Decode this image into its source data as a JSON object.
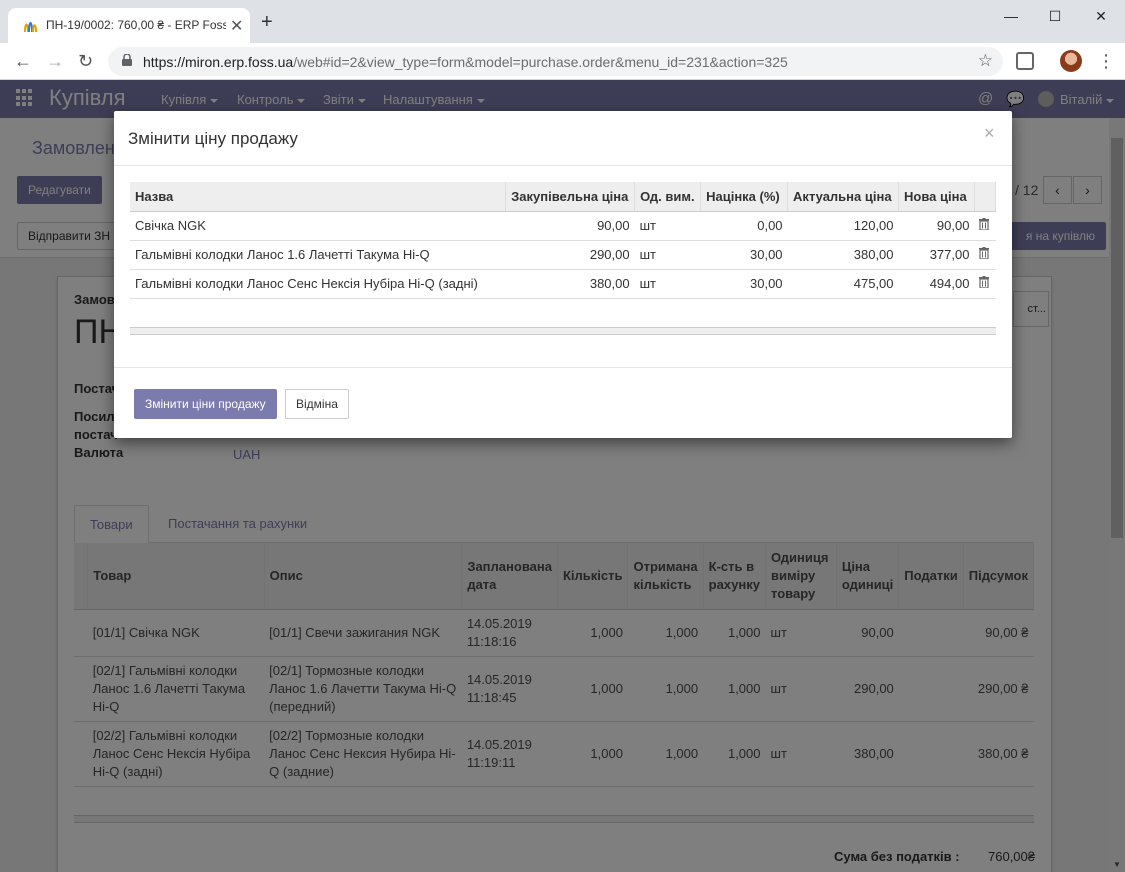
{
  "browser": {
    "tab_title": "ПН-19/0002: 760,00 ₴ - ERP Foss",
    "url_host": "https://miron.erp.foss.ua",
    "url_path": "/web#id=2&view_type=form&model=purchase.order&menu_id=231&action=325"
  },
  "app": {
    "brand": "Купівля",
    "menu": [
      "Купівля",
      "Контроль",
      "Звіти",
      "Налаштування"
    ],
    "user": "Віталій"
  },
  "control_panel": {
    "breadcrumb": "Замовлен",
    "edit_label": "Редагувати",
    "send_label": "Відправити ЗН",
    "confirm_label": "я на купівлю",
    "pager": "/ 12"
  },
  "form": {
    "order_label": "Замов",
    "title": "ПН",
    "supplier_label": "Постач",
    "ref_label_1": "Посила",
    "ref_label_2": "постач",
    "currency_label": "Валюта",
    "currency_value": "UAH",
    "status_btn": "ст...",
    "tabs": [
      "Товари",
      "Постачання та рахунки"
    ],
    "line_headers": [
      "Товар",
      "Опис",
      "Запланована дата",
      "Кількість",
      "Отримана кількість",
      "К-сть в рахунку",
      "Одиниця виміру товару",
      "Ціна одиниці",
      "Податки",
      "Підсумок"
    ],
    "lines": [
      {
        "product": "[01/1] Свічка NGK",
        "desc": "[01/1] Свечи зажигания NGK",
        "date": "14.05.2019 11:18:16",
        "qty": "1,000",
        "received": "1,000",
        "invoiced": "1,000",
        "uom": "шт",
        "price": "90,00",
        "taxes": "",
        "subtotal": "90,00 ₴"
      },
      {
        "product": "[02/1] Гальмівні колодки Ланос 1.6 Лачетті Такума Hi-Q",
        "desc": "[02/1] Тормозные колодки Ланос 1.6 Лачетти Такума Hi-Q (передний)",
        "date": "14.05.2019 11:18:45",
        "qty": "1,000",
        "received": "1,000",
        "invoiced": "1,000",
        "uom": "шт",
        "price": "290,00",
        "taxes": "",
        "subtotal": "290,00 ₴"
      },
      {
        "product": "[02/2] Гальмівні колодки Ланос Сенс Нексія Нубіра Hi-Q (задні)",
        "desc": "[02/2] Тормозные колодки Ланос Сенс Нексия Нубира Hi-Q (задние)",
        "date": "14.05.2019 11:19:11",
        "qty": "1,000",
        "received": "1,000",
        "invoiced": "1,000",
        "uom": "шт",
        "price": "380,00",
        "taxes": "",
        "subtotal": "380,00 ₴"
      }
    ],
    "total_label": "Сума без податків :",
    "total_value": "760,00₴"
  },
  "modal": {
    "title": "Змінити ціну продажу",
    "close": "×",
    "headers": [
      "Назва",
      "Закупівельна ціна",
      "Од. вим.",
      "Націнка (%)",
      "Актуальна ціна",
      "Нова ціна"
    ],
    "rows": [
      {
        "name": "Свічка NGK",
        "cost": "90,00",
        "uom": "шт",
        "markup": "0,00",
        "current": "120,00",
        "new": "90,00"
      },
      {
        "name": "Гальмівні колодки Ланос 1.6 Лачетті Такума Hi-Q",
        "cost": "290,00",
        "uom": "шт",
        "markup": "30,00",
        "current": "380,00",
        "new": "377,00"
      },
      {
        "name": "Гальмівні колодки Ланос Сенс Нексія Нубіра Hi-Q (задні)",
        "cost": "380,00",
        "uom": "шт",
        "markup": "30,00",
        "current": "475,00",
        "new": "494,00"
      }
    ],
    "apply_label": "Змінити ціни продажу",
    "cancel_label": "Відміна"
  },
  "colors": {
    "brand": "#7c7bad"
  }
}
